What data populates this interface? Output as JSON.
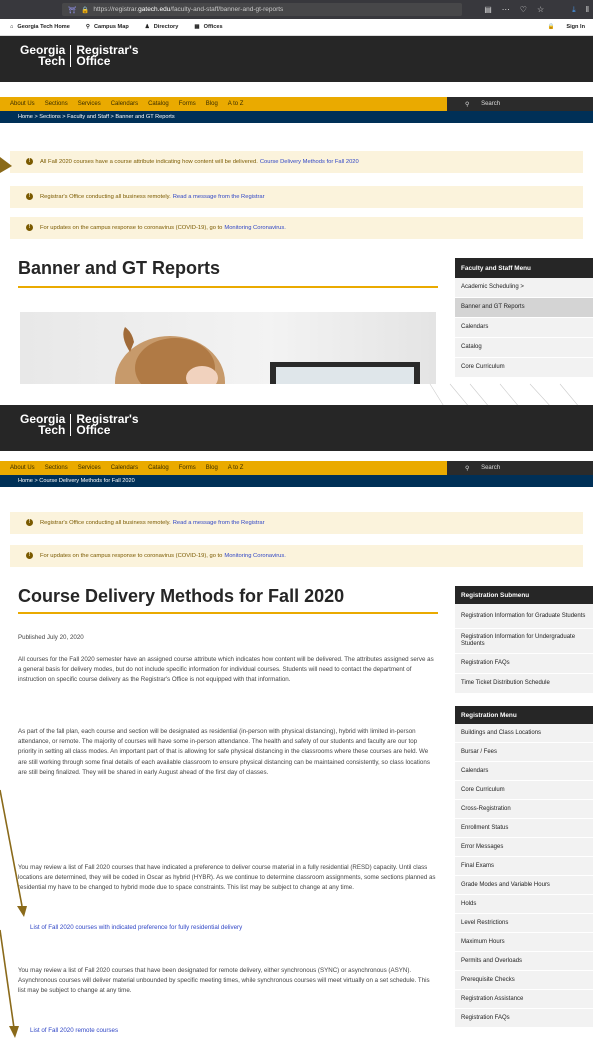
{
  "browser": {
    "url_prefix": "https://registrar.",
    "url_domain": "gatech.edu",
    "url_path": "/faculty-and-staff/banner-and-gt-reports"
  },
  "utility": {
    "items": [
      "Georgia Tech Home",
      "Campus Map",
      "Directory",
      "Offices"
    ],
    "sign_in": "Sign In"
  },
  "logo": {
    "line1": "Georgia",
    "line2": "Tech",
    "line3": "Registrar's",
    "line4": "Office"
  },
  "nav": {
    "items": [
      "About Us",
      "Sections",
      "Services",
      "Calendars",
      "Catalog",
      "Forms",
      "Blog",
      "A to Z"
    ],
    "search": "Search"
  },
  "page1": {
    "breadcrumb": "Home   >   Sections   >   Faculty and Staff   >   Banner and GT Reports",
    "alerts": [
      {
        "text": "All Fall 2020 courses have a course attribute indicating how content will be delivered.",
        "link": "Course Delivery Methods for Fall 2020"
      },
      {
        "text": "Registrar's Office conducting all business remotely.",
        "link": "Read a message from the Registrar"
      },
      {
        "text": "For updates on the campus response to coronavirus (COVID-19), go to",
        "link": "Monitoring Coronavirus."
      }
    ],
    "title": "Banner and GT Reports",
    "menu_title": "Faculty and Staff Menu",
    "menu": [
      "Academic Scheduling  >",
      "Banner and GT Reports",
      "Calendars",
      "Catalog",
      "Core Curriculum"
    ]
  },
  "page2": {
    "breadcrumb": "Home   >   Course Delivery Methods for Fall 2020",
    "alerts": [
      {
        "text": "Registrar's Office conducting all business remotely.",
        "link": "Read a message from the Registrar"
      },
      {
        "text": "For updates on the campus response to coronavirus (COVID-19), go to",
        "link": "Monitoring Coronavirus."
      }
    ],
    "title": "Course Delivery Methods for Fall 2020",
    "published": "Published July 20, 2020",
    "para1": "All courses for the Fall 2020 semester have an assigned course attribute which indicates how content will be delivered. The attributes assigned serve as a general basis for delivery modes, but do not include specific information for individual courses. Students will need to contact the department of instruction on specific course delivery as the Registrar's Office is not equipped with that information.",
    "para2": "As part of the fall plan, each course and section will be designated as residential (in-person with physical distancing), hybrid with limited in-person attendance, or remote. The majority of courses will have some in-person attendance. The health and safety of our students and faculty are our top priority in setting all class modes. An important part of that is allowing for safe physical distancing in the classrooms where these courses are held. We are still working through some final details of each available classroom to ensure physical distancing can be maintained consistently, so class locations are still being finalized. They will be shared in early August ahead of the first day of classes.",
    "para3": "You may review a list of Fall 2020 courses that have indicated a preference to deliver course material in a fully residential (RESD) capacity. Until class locations are determined, they will be coded in Oscar as hybrid (HYBR). As we continue to determine classroom assignments, some sections planned as residential my have to be changed to hybrid mode due to space constraints. This list may be subject to change at any time.",
    "link1": "List of Fall 2020 courses with indicated preference for fully residential delivery",
    "para4": "You may review a list of Fall 2020 courses that have been designated for remote delivery, either synchronous (SYNC) or asynchronous (ASYN). Asynchronous courses will deliver material unbounded by specific meeting times, while synchronous courses will meet virtually on a set schedule. This list may be subject to change at any time.",
    "link2": "List of Fall 2020 remote courses",
    "submenu_title": "Registration Submenu",
    "submenu": [
      "Registration Information for Graduate Students",
      "Registration Information for Undergraduate Students",
      "Registration FAQs",
      "Time Ticket Distribution Schedule"
    ],
    "menu_title": "Registration Menu",
    "menu": [
      "Buildings and Class Locations",
      "Bursar / Fees",
      "Calendars",
      "Core Curriculum",
      "Cross-Registration",
      "Enrollment Status",
      "Error Messages",
      "Final Exams",
      "Grade Modes and Variable Hours",
      "Holds",
      "Level Restrictions",
      "Maximum Hours",
      "Permits and Overloads",
      "Prerequisite Checks",
      "Registration Assistance",
      "Registration FAQs"
    ]
  },
  "colors": {
    "gold": "#eaaa00",
    "navy": "#003057",
    "dark": "#262626",
    "alert_bg": "#fbf3dc",
    "link": "#3147c6"
  }
}
